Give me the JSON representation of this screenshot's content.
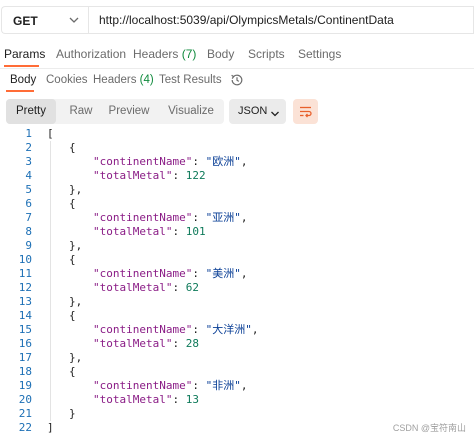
{
  "request": {
    "method": "GET",
    "url": "http://localhost:5039/api/OlympicsMetals/ContinentData"
  },
  "request_tabs": [
    {
      "label": "Params",
      "count": ""
    },
    {
      "label": "Authorization",
      "count": ""
    },
    {
      "label": "Headers",
      "count": "(7)"
    },
    {
      "label": "Body",
      "count": ""
    },
    {
      "label": "Scripts",
      "count": ""
    },
    {
      "label": "Settings",
      "count": ""
    }
  ],
  "response_tabs": [
    {
      "label": "Body",
      "count": ""
    },
    {
      "label": "Cookies",
      "count": ""
    },
    {
      "label": "Headers",
      "count": "(4)"
    },
    {
      "label": "Test Results",
      "count": ""
    }
  ],
  "format_buttons": [
    "Pretty",
    "Raw",
    "Preview",
    "Visualize"
  ],
  "format_select": "JSON",
  "icons": {
    "method_dropdown": "chevron-down-icon",
    "format_dropdown": "chevron-down-icon",
    "history": "history-icon",
    "wrap": "text-wrap-icon"
  },
  "colors": {
    "accent": "#ff6c37",
    "count": "#0f8a3c",
    "line_number": "#1c6fb5",
    "json_key": "#8a1c86",
    "json_string": "#0a3f96",
    "json_number": "#0e7a5a"
  },
  "response_body": {
    "key_name": "\"continentName\"",
    "key_metal": "\"totalMetal\"",
    "items": [
      {
        "continentName": "\"欧洲\"",
        "totalMetal": "122"
      },
      {
        "continentName": "\"亚洲\"",
        "totalMetal": "101"
      },
      {
        "continentName": "\"美洲\"",
        "totalMetal": "62"
      },
      {
        "continentName": "\"大洋洲\"",
        "totalMetal": "28"
      },
      {
        "continentName": "\"非洲\"",
        "totalMetal": "13"
      }
    ]
  },
  "line_numbers": [
    "1",
    "2",
    "3",
    "4",
    "5",
    "6",
    "7",
    "8",
    "9",
    "10",
    "11",
    "12",
    "13",
    "14",
    "15",
    "16",
    "17",
    "18",
    "19",
    "20",
    "21",
    "22"
  ],
  "watermark": "CSDN @宝符南山"
}
